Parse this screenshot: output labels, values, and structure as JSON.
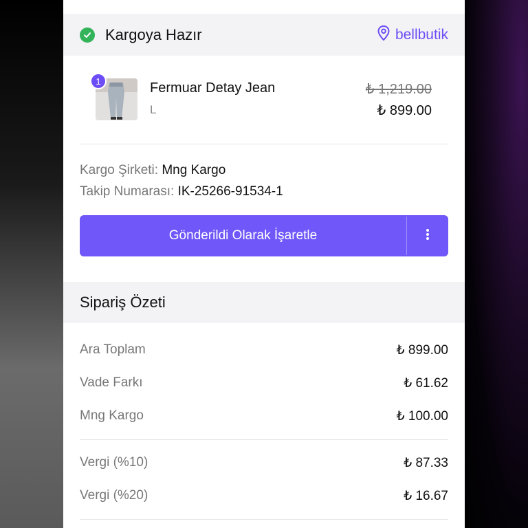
{
  "status": {
    "title": "Kargoya Hazır",
    "store": "bellbutik",
    "status_color": "#33b35a",
    "accent_color": "#6c4df6"
  },
  "product": {
    "quantity_badge": "1",
    "name": "Fermuar Detay Jean",
    "variant": "L",
    "price_old": "₺ 1,219.00",
    "price_new": "₺ 899.00"
  },
  "shipping": {
    "company_label": "Kargo Şirketi:",
    "company_value": "Mng Kargo",
    "tracking_label": "Takip Numarası:",
    "tracking_value": "IK-25266-91534-1"
  },
  "actions": {
    "mark_shipped_label": "Gönderildi Olarak İşaretle",
    "more_icon": "vertical-ellipsis-icon"
  },
  "summary": {
    "title": "Sipariş Özeti",
    "rows_group1": [
      {
        "label": "Ara Toplam",
        "amount": "₺ 899.00"
      },
      {
        "label": "Vade Farkı",
        "amount": "₺ 61.62"
      },
      {
        "label": "Mng Kargo",
        "amount": "₺ 100.00"
      }
    ],
    "rows_group2": [
      {
        "label": "Vergi (%10)",
        "amount": "₺ 87.33"
      },
      {
        "label": "Vergi (%20)",
        "amount": "₺ 16.67"
      }
    ]
  }
}
